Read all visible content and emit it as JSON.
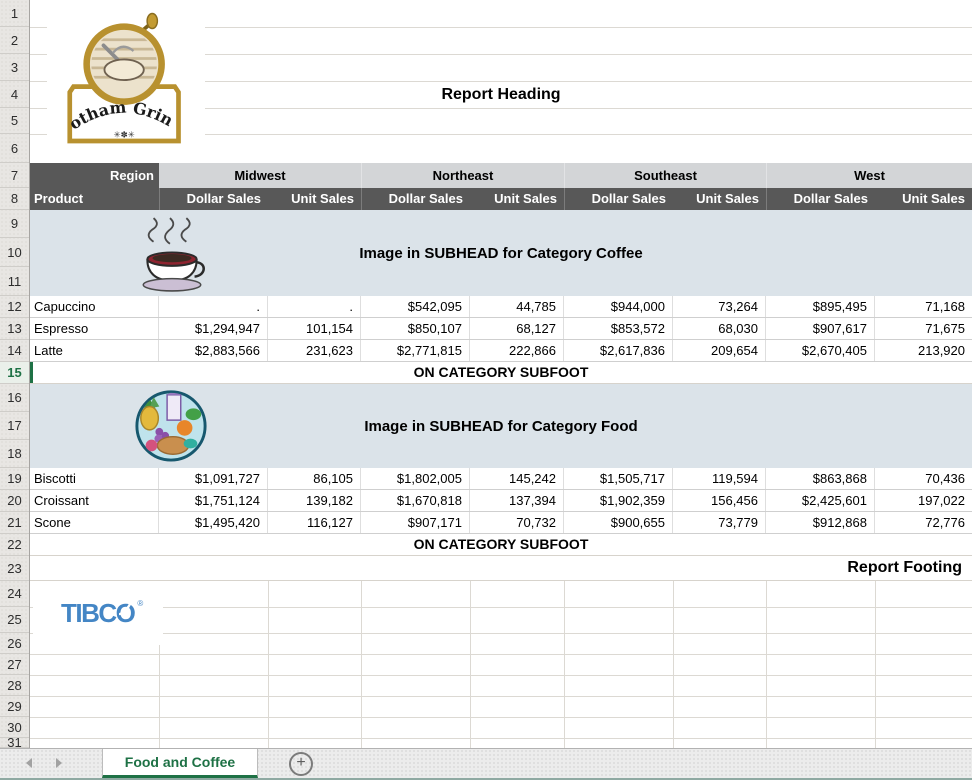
{
  "sheet": {
    "row_numbers": [
      "1",
      "2",
      "3",
      "4",
      "5",
      "6",
      "7",
      "8",
      "9",
      "10",
      "11",
      "12",
      "13",
      "14",
      "15",
      "16",
      "17",
      "18",
      "19",
      "20",
      "21",
      "22",
      "23",
      "24",
      "25",
      "26",
      "27",
      "28",
      "29",
      "30",
      "31"
    ],
    "active_row": "15"
  },
  "report": {
    "heading": "Report Heading",
    "footing": "Report Footing"
  },
  "table": {
    "region_label": "Region",
    "product_label": "Product",
    "regions": [
      "Midwest",
      "Northeast",
      "Southeast",
      "West"
    ],
    "measure_headers": [
      "Dollar Sales",
      "Unit Sales"
    ],
    "categories": [
      {
        "name": "Coffee",
        "subhead": "Image in SUBHEAD for Category Coffee",
        "subfoot": "ON CATEGORY SUBFOOT",
        "image": "coffee-cup-image",
        "products": [
          {
            "name": "Capuccino",
            "cells": [
              ".",
              ".",
              "$542,095",
              "44,785",
              "$944,000",
              "73,264",
              "$895,495",
              "71,168"
            ]
          },
          {
            "name": "Espresso",
            "cells": [
              "$1,294,947",
              "101,154",
              "$850,107",
              "68,127",
              "$853,572",
              "68,030",
              "$907,617",
              "71,675"
            ]
          },
          {
            "name": "Latte",
            "cells": [
              "$2,883,566",
              "231,623",
              "$2,771,815",
              "222,866",
              "$2,617,836",
              "209,654",
              "$2,670,405",
              "213,920"
            ]
          }
        ]
      },
      {
        "name": "Food",
        "subhead": "Image in SUBHEAD for Category Food",
        "subfoot": "ON CATEGORY SUBFOOT",
        "image": "food-basket-image",
        "products": [
          {
            "name": "Biscotti",
            "cells": [
              "$1,091,727",
              "86,105",
              "$1,802,005",
              "145,242",
              "$1,505,717",
              "119,594",
              "$863,868",
              "70,436"
            ]
          },
          {
            "name": "Croissant",
            "cells": [
              "$1,751,124",
              "139,182",
              "$1,670,818",
              "137,394",
              "$1,902,359",
              "156,456",
              "$2,425,601",
              "197,022"
            ]
          },
          {
            "name": "Scone",
            "cells": [
              "$1,495,420",
              "116,127",
              "$907,171",
              "70,732",
              "$900,655",
              "73,779",
              "$912,868",
              "72,776"
            ]
          }
        ]
      }
    ]
  },
  "branding": {
    "company_logo": "Gotham Grinds",
    "vendor_logo": "TIBCO",
    "vendor_logo_mark": "®"
  },
  "tabs": {
    "active": "Food and Coffee",
    "add_sheet": "+"
  },
  "colors": {
    "header_dark": "#585858",
    "region_band": "#d3d5d7",
    "subhead_bg": "#dbe3e9",
    "excel_green": "#1e7145",
    "tibco_blue": "#4486c5"
  }
}
